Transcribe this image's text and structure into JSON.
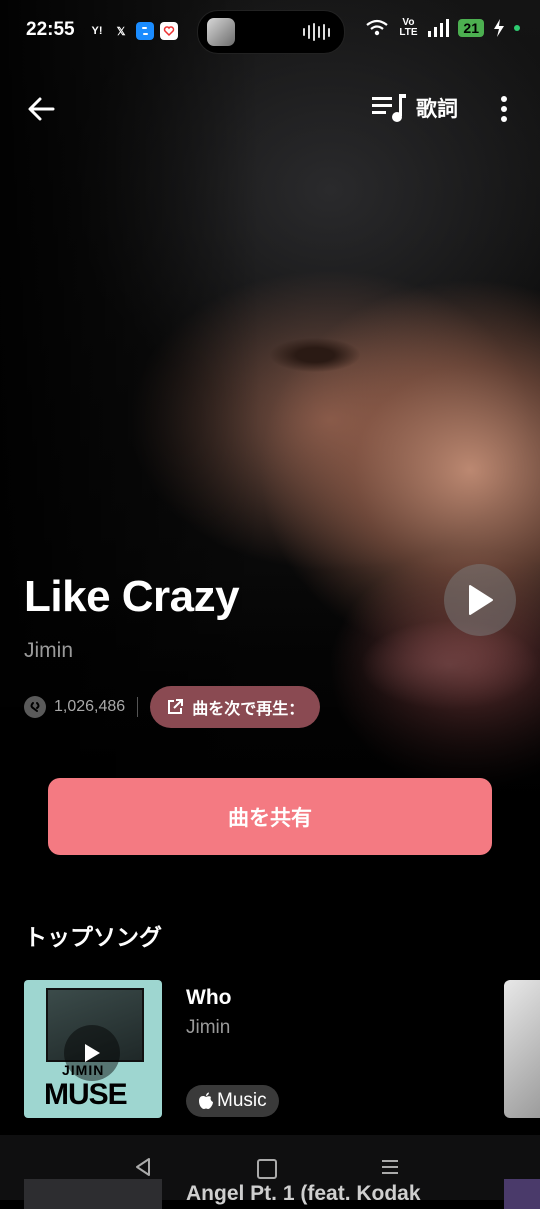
{
  "status_bar": {
    "time": "22:55",
    "apps": [
      "Y!",
      "𝕏"
    ],
    "network": "Vo LTE",
    "battery": "21"
  },
  "header": {
    "lyrics_label": "歌詞"
  },
  "song": {
    "title": "Like Crazy",
    "artist": "Jimin",
    "shazam_count": "1,026,486",
    "play_next_label": "曲を次で再生："
  },
  "share_button_label": "曲を共有",
  "top_songs": {
    "section_title": "トップソング",
    "items": [
      {
        "title": "Who",
        "artist": "Jimin",
        "cover_text_top": "JIMIN",
        "cover_text_bottom": "MUSE",
        "badge": "Music"
      }
    ],
    "next_peek_title": "Angel Pt. 1 (feat. Kodak"
  },
  "colors": {
    "accent": "#f47a82",
    "play_next_bg": "#8a4a52",
    "cover_bg": "#9ed6d0"
  }
}
